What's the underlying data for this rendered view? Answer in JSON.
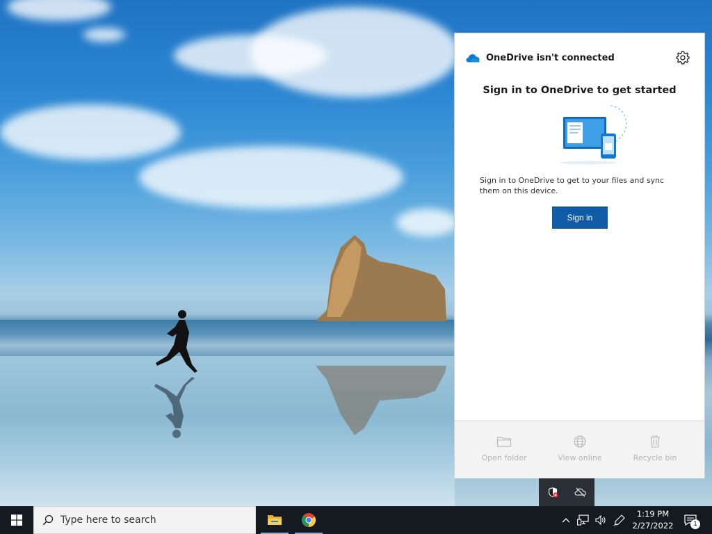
{
  "onedrive": {
    "title": "OneDrive isn't connected",
    "headline": "Sign in to OneDrive to get started",
    "description": "Sign in to OneDrive to get to your files and sync them on this device.",
    "signin_label": "Sign in",
    "footer": {
      "open_folder": "Open folder",
      "view_online": "View online",
      "recycle_bin": "Recycle bin"
    },
    "accent": "#0f5ba8"
  },
  "taskbar": {
    "search_placeholder": "Type here to search",
    "time": "1:19 PM",
    "date": "2/27/2022",
    "notification_count": "1",
    "apps": [
      "file-explorer-icon",
      "chrome-icon"
    ]
  }
}
